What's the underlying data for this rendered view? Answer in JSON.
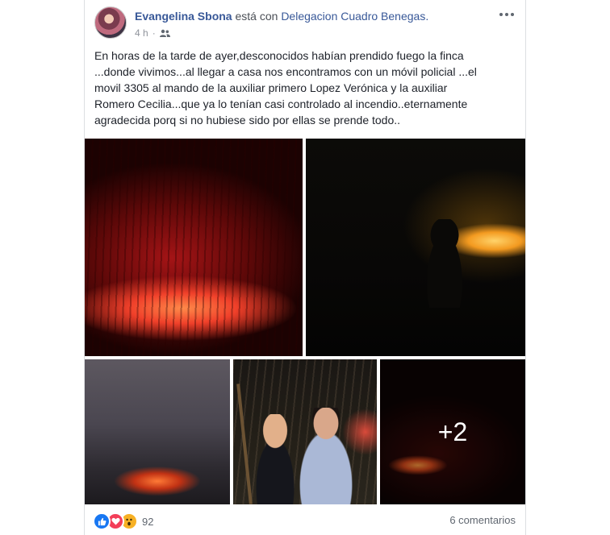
{
  "post": {
    "author": "Evangelina Sbona",
    "with_text": "está con",
    "tagged_place": "Delegacion Cuadro Benegas.",
    "timestamp": "4 h",
    "separator": "·",
    "audience_icon": "friends-icon",
    "more_icon": "more-options-icon",
    "text": "En horas de la tarde de ayer,desconocidos habían prendido fuego la finca\n...donde vivimos...al llegar a casa nos encontramos con un móvil policial ...el\nmovil 3305 al mando de la auxiliar primero Lopez Verónica y la auxiliar\nRomero Cecilia...que ya lo tenían casi controlado al incendio..eternamente\nagradecida porq si no hubiese sido por ellas se prende todo.."
  },
  "photos": {
    "more_count": "+2"
  },
  "footer": {
    "reaction_icons": [
      "like-icon",
      "love-icon",
      "wow-icon"
    ],
    "reaction_count": "92",
    "comments_count": "6 comentarios"
  },
  "colors": {
    "link": "#385898",
    "text": "#1d2129",
    "meta": "#90949c",
    "like": "#1877f2",
    "love": "#f33e58",
    "wow": "#f7b125"
  }
}
